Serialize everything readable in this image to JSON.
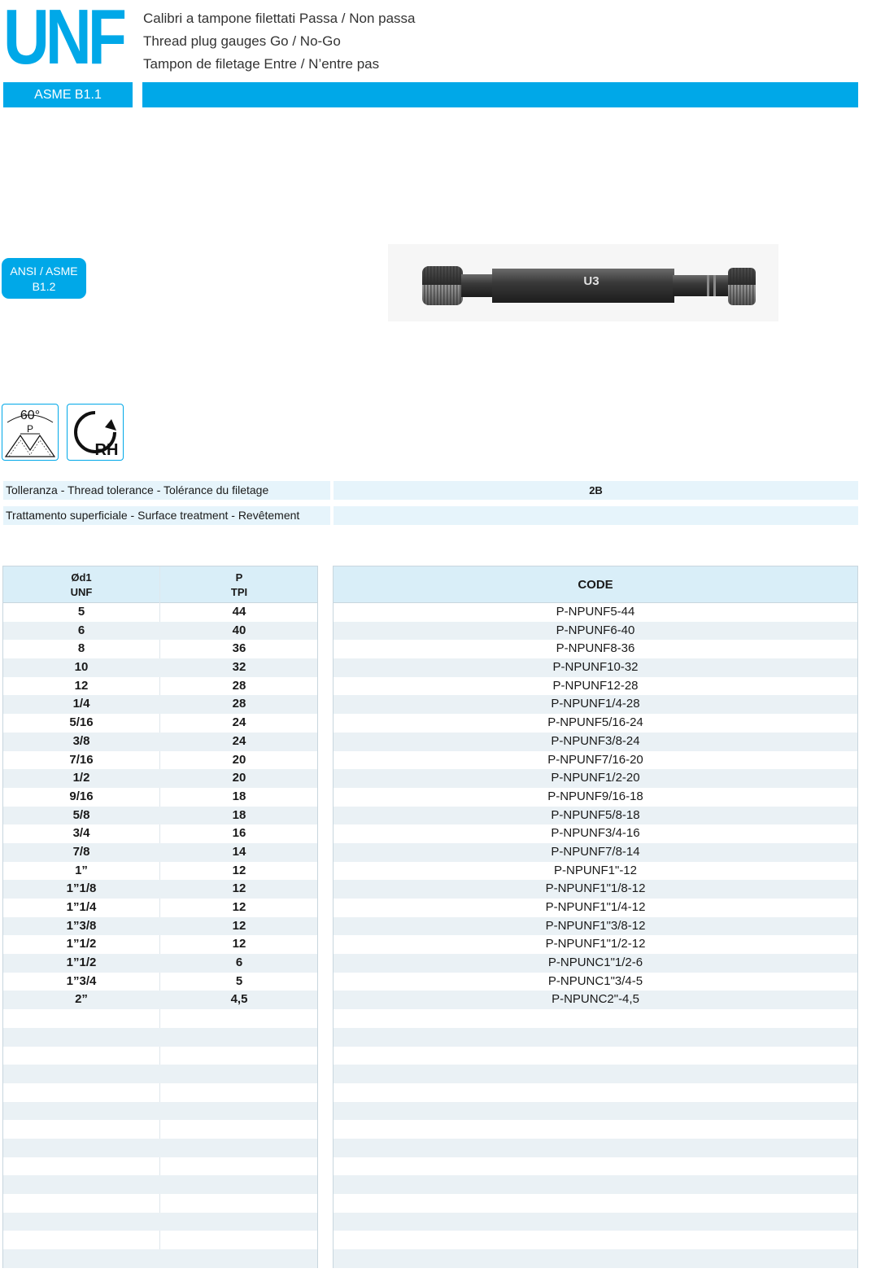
{
  "header": {
    "brand": "UNF",
    "title_it": "Calibri a tampone filettati Passa / Non passa",
    "title_en": "Thread plug gauges Go / No-Go",
    "title_fr": "Tampon de filetage Entre / N’entre pas",
    "standard": "ASME B1.1",
    "accent_color": "#00a8e8"
  },
  "badge": {
    "line1": "ANSI / ASME",
    "line2": "B1.2"
  },
  "product_image": {
    "logo_text": "U3"
  },
  "symbols": {
    "angle": "60°",
    "pitch": "P",
    "rotation": "RH"
  },
  "specs": [
    {
      "label": "Tolleranza - Thread tolerance - Tolérance du filetage",
      "value": "2B"
    },
    {
      "label": "Trattamento superficiale - Surface treatment - Revêtement",
      "value": ""
    }
  ],
  "table": {
    "col1": {
      "line1": "Ød1",
      "line2": "UNF"
    },
    "col2": {
      "line1": "P",
      "line2": "TPI"
    },
    "code_header": "CODE",
    "rows": [
      {
        "d": "5",
        "p": "44",
        "code": "P-NPUNF5-44"
      },
      {
        "d": "6",
        "p": "40",
        "code": "P-NPUNF6-40"
      },
      {
        "d": "8",
        "p": "36",
        "code": "P-NPUNF8-36"
      },
      {
        "d": "10",
        "p": "32",
        "code": "P-NPUNF10-32"
      },
      {
        "d": "12",
        "p": "28",
        "code": "P-NPUNF12-28"
      },
      {
        "d": "1/4",
        "p": "28",
        "code": "P-NPUNF1/4-28"
      },
      {
        "d": "5/16",
        "p": "24",
        "code": "P-NPUNF5/16-24"
      },
      {
        "d": "3/8",
        "p": "24",
        "code": "P-NPUNF3/8-24"
      },
      {
        "d": "7/16",
        "p": "20",
        "code": "P-NPUNF7/16-20"
      },
      {
        "d": "1/2",
        "p": "20",
        "code": "P-NPUNF1/2-20"
      },
      {
        "d": "9/16",
        "p": "18",
        "code": "P-NPUNF9/16-18"
      },
      {
        "d": "5/8",
        "p": "18",
        "code": "P-NPUNF5/8-18"
      },
      {
        "d": "3/4",
        "p": "16",
        "code": "P-NPUNF3/4-16"
      },
      {
        "d": "7/8",
        "p": "14",
        "code": "P-NPUNF7/8-14"
      },
      {
        "d": "1”",
        "p": "12",
        "code": "P-NPUNF1\"-12"
      },
      {
        "d": "1”1/8",
        "p": "12",
        "code": "P-NPUNF1\"1/8-12"
      },
      {
        "d": "1”1/4",
        "p": "12",
        "code": "P-NPUNF1\"1/4-12"
      },
      {
        "d": "1”3/8",
        "p": "12",
        "code": "P-NPUNF1\"3/8-12"
      },
      {
        "d": "1”1/2",
        "p": "12",
        "code": "P-NPUNF1\"1/2-12"
      },
      {
        "d": "1”1/2",
        "p": "6",
        "code": "P-NPUNC1\"1/2-6"
      },
      {
        "d": "1”3/4",
        "p": "5",
        "code": "P-NPUNC1\"3/4-5"
      },
      {
        "d": "2”",
        "p": "4,5",
        "code": "P-NPUNC2\"-4,5"
      },
      {
        "d": "",
        "p": "",
        "code": ""
      },
      {
        "d": "",
        "p": "",
        "code": ""
      },
      {
        "d": "",
        "p": "",
        "code": ""
      },
      {
        "d": "",
        "p": "",
        "code": ""
      },
      {
        "d": "",
        "p": "",
        "code": ""
      },
      {
        "d": "",
        "p": "",
        "code": ""
      },
      {
        "d": "",
        "p": "",
        "code": ""
      },
      {
        "d": "",
        "p": "",
        "code": ""
      },
      {
        "d": "",
        "p": "",
        "code": ""
      },
      {
        "d": "",
        "p": "",
        "code": ""
      },
      {
        "d": "",
        "p": "",
        "code": ""
      },
      {
        "d": "",
        "p": "",
        "code": ""
      },
      {
        "d": "",
        "p": "",
        "code": ""
      },
      {
        "d": "",
        "p": "",
        "code": ""
      },
      {
        "d": "",
        "p": "",
        "code": ""
      }
    ]
  }
}
